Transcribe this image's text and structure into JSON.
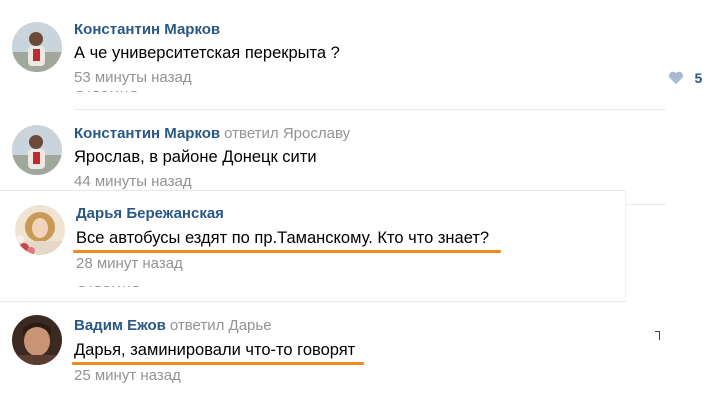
{
  "comments": [
    {
      "author": "Константин Марков",
      "reply_to": "",
      "text": "А че университетская перекрыта ?",
      "time": "53 минуты назад",
      "likes": "5"
    },
    {
      "author": "Константин Марков",
      "reply_to": "ответил Ярославу",
      "text": "Ярослав, в районе Донецк сити",
      "time": "44 минуты назад"
    },
    {
      "author": "Дарья Бережанская",
      "reply_to": "",
      "text": "Все автобусы ездят по пр.Таманскому. Кто что знает?",
      "time": "28 минут назад"
    },
    {
      "author": "Вадим Ежов",
      "reply_to": "ответил Дарье",
      "text": "Дарья, заминировали что-то говорят",
      "time": "25 минут назад"
    }
  ],
  "colors": {
    "author": "#2a5885",
    "meta": "#939393",
    "highlight": "#f08a1f",
    "like_icon": "#a8bbd1"
  },
  "icons": {
    "like": "heart-icon"
  }
}
